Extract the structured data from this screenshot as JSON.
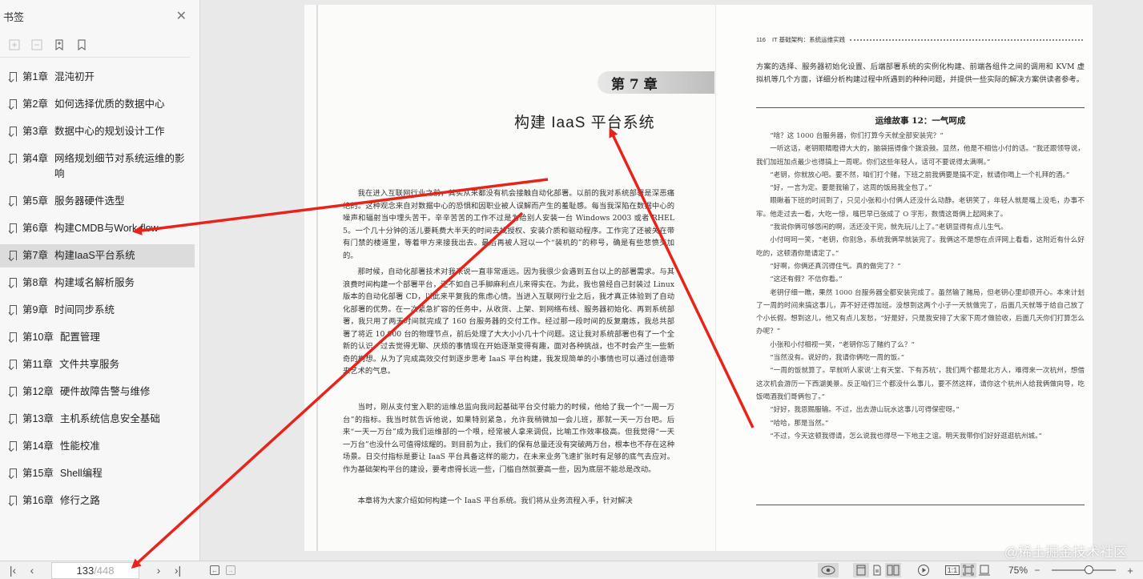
{
  "sidebar": {
    "title": "书签",
    "items": [
      {
        "num": "第1章",
        "title": "混沌初开"
      },
      {
        "num": "第2章",
        "title": "如何选择优质的数据中心"
      },
      {
        "num": "第3章",
        "title": "数据中心的规划设计工作"
      },
      {
        "num": "第4章",
        "title": "网络规划细节对系统运维的影响"
      },
      {
        "num": "第5章",
        "title": "服务器硬件选型"
      },
      {
        "num": "第6章",
        "title": "构建CMDB与Work-flow"
      },
      {
        "num": "第7章",
        "title": "构建IaaS平台系统"
      },
      {
        "num": "第8章",
        "title": "构建域名解析服务"
      },
      {
        "num": "第9章",
        "title": "时间同步系统"
      },
      {
        "num": "第10章",
        "title": "配置管理"
      },
      {
        "num": "第11章",
        "title": "文件共享服务"
      },
      {
        "num": "第12章",
        "title": "硬件故障告警与维修"
      },
      {
        "num": "第13章",
        "title": "主机系统信息安全基础"
      },
      {
        "num": "第14章",
        "title": "性能校准"
      },
      {
        "num": "第15章",
        "title": "Shell编程"
      },
      {
        "num": "第16章",
        "title": "修行之路"
      }
    ],
    "active_index": 6
  },
  "left_page": {
    "chapter_badge": "第 7 章",
    "chapter_title": "构建 IaaS 平台系统",
    "paragraphs": [
      "我在进入互联网行业之前，其实从来都没有机会接触自动化部署。以前的我对系统部署是深恶痛绝的。这种观念来自对数据中心的恐惧和因职业被人误解而产生的羞耻感。每当我深陷在数据中心的噪声和辐射当中埋头苦干，辛辛苦苦的工作不过是为给别人安装一台 Windows 2003 或者 RHEL 5。一个几十分钟的活儿要耗费大半天的时间去找授权、安装介质和驱动程序。工作完了还被关在带有门禁的楼道里，等着甲方来接我出去。最后再被人冠以一个“装机的”的称号，确是有些悲愤交加的。",
      "那时候，自动化部署技术对我来说一直非常遥远。因为我很少会遇到五台以上的部署需求。与其浪费时间构建一个部署平台，还不如自己手脚麻利点儿来得实在。为此，我也曾经自己封装过 Linux 版本的自动化部署 CD，以此来平复我的焦虑心情。当进入互联网行业之后，我才真正体验到了自动化部署的优势。在一次紧急扩容的任务中，从收货、上架、到网络布线、服务器初始化、再到系统部署，我只用了两天时间就完成了 160 台服务器的交付工作。经过那一段时间的反复磨炼，我总共部署了将近 10 000 台的物理节点，前后处理了大大小小几十个问题。这让我对系统部署也有了一个全新的认识。过去觉得无聊、厌烦的事情现在开始逐渐变得有趣，面对各种挑战，也不时会产生一些新奇的构想。从为了完成高效交付到逐步思考 IaaS 平台构建，我发现简单的小事情也可以通过创造带来艺术的气息。",
      "当时，刚从支付宝入职的运维总监向我问起基础平台交付能力的时候，他给了我一个“一周一万台”的指标。我当时就告诉他说，如果特别紧急，允许我稍微加一会儿班，那就一天一万台吧。后来“一天一万台”成为我们运维部的一个哏，经常被人拿来调侃，比喻工作效率极高。但我觉得“一天一万台”也没什么可值得炫耀的。到目前为止，我们的保有总量还没有突破两万台，根本也不存在这种场景。日交付指标是要让 IaaS 平台具备这样的能力，在未来业务飞速扩张时有足够的底气去应对。作为基础架构平台的建设，要考虑得长远一些，门槛自然就要高一些，因为底层不能总是改动。",
      "本章将为大家介绍如何构建一个 IaaS 平台系统。我们将从业务流程入手，针对解决"
    ]
  },
  "right_page": {
    "page_number": "116",
    "header_title": "IT 基础架构：系统运维实践",
    "intro": "方案的选择、服务器初始化设置、后端部署系统的实例化构建、前端各组件之间的调用和 KVM 虚拟机等几个方面，详细分析构建过程中所遇到的种种问题，并提供一些实际的解决方案供读者参考。",
    "story_title": "运维故事 12：一气呵成",
    "story": [
      "“啥？这 1000 台服务器，你们打算今天就全部安装完？”",
      "一听这话，老钥眼睛瞪得大大的，脑袋摇得像个拨浪鼓。显然，他是不相信小付的话。“我还跟领导说，我们加班加点最少也得搞上一周呢。你们这些年轻人，话可不要说得太满啊。”",
      "“老钥，你就放心吧。要不然，咱们打个赌，下班之前我俩要是搞不定，就请你喝上一个礼拜的酒。”",
      "“好，一言为定。要是我输了，这周的饭局我全包了。”",
      "眼瞅着下班的时间到了，只见小张和小付俩人还没什么动静。老钥笑了，年轻人就是嘴上没毛，办事不牢。他走过去一看，大吃一惊，嘴巴早已张成了 O 字形，数情这哥俩上起网来了。",
      "“我说你俩可够悠闲的啊，活还没干完，就先玩儿上了。”老钥显得有点儿生气。",
      "小付呵呵一笑，“老钥，你别急，系统我俩早就装完了。我俩这不是想在点评网上看看，这附近有什么好吃的，这顿酒你是请定了。”",
      "“好啊，你俩还真沉得住气。真的做完了？”",
      "“这还有假？不信你看。”",
      "老钥仔细一瞧，果然 1000 台服务器全都安装完成了。虽然输了赌局，但老钥心里却很开心。本来计划了一周的时间来搞这事儿，弄不好还得加班。没想到这两个小子一天就做完了，后面几天就等于给自己放了个小长假。想到这儿，他又有点儿发愁，“好是好，只是我安排了大家下周才做验收，后面几天你们打算怎么办呢？”",
      "小张和小付相视一笑，“老钥你忘了赌约了么？”",
      "“当然没有。说好的，我请你俩吃一周的饭。”",
      "“一周的饭就算了。早就听人家说‘上有天堂、下有苏杭’，我们两个都是北方人，难得来一次杭州，想借这次机会游历一下西湖美景。反正咱们三个都没什么事儿，要不然这样，请你这个杭州人给我俩做向导，吃饭喝酒我们哥俩包了。”",
      "“好好，我恩赐服输。不过，出去游山玩水这事儿可得保密呀。”",
      "“哈哈，那是当然。”",
      "“不过，今天这顿我得请，怎么说我也得尽一下地主之谊。明天我带你们好好逛逛杭州城。”"
    ]
  },
  "watermark": "@稀土掘金技术社区",
  "bottombar": {
    "current_page": "133",
    "total_pages": "/448",
    "zoom": "75%",
    "zoom_fraction": 0.58
  },
  "colors": {
    "arrow": "#e8231a",
    "active_item_bg": "#dcdcdc"
  }
}
